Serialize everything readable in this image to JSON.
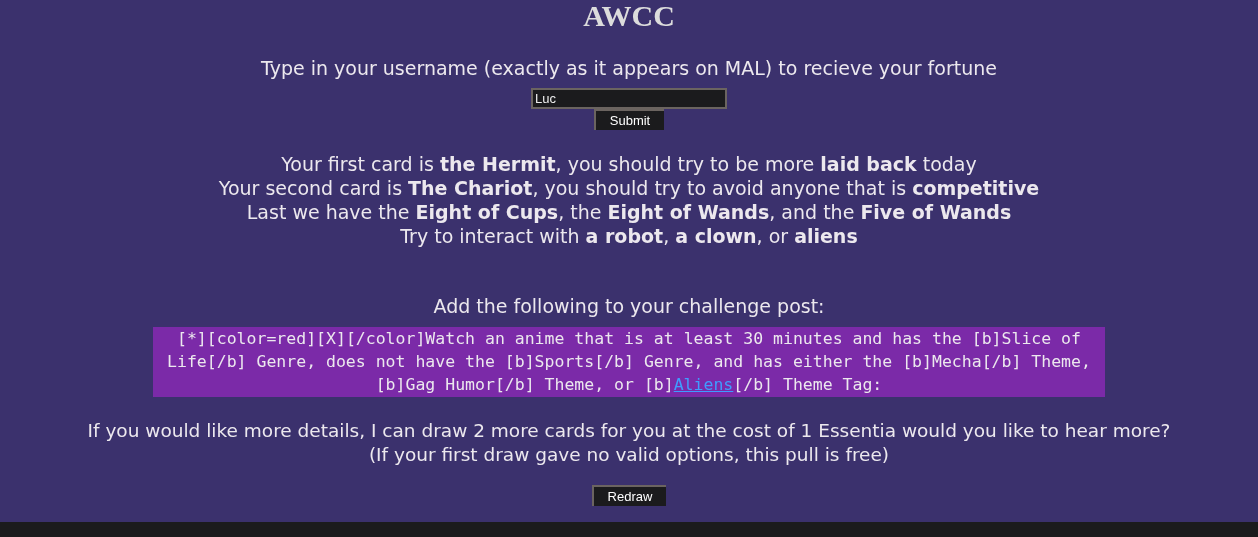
{
  "title": "AWCC",
  "prompt": "Type in your username (exactly as it appears on MAL) to recieve your fortune",
  "username_field": {
    "value": "Luc"
  },
  "submit_button": "Submit",
  "fortune_lines": [
    "Your first card is **the Hermit**, you should try to be more **laid back** today",
    "Your second card is **The Chariot**, you should try to avoid anyone that is **competitive**",
    "Last we have the **Eight of Cups**, the **Eight of Wands**, and the **Five of Wands**",
    "Try to interact with **a robot**, **a clown**, or **aliens**"
  ],
  "challenge_heading": "Add the following to your challenge post:",
  "challenge_code": {
    "before": "[*][color=red][X][/color]Watch an anime that is at least 30 minutes and has the [b]Slice of Life[/b] Genre, does not have the [b]Sports[/b] Genre, and has either the [b]Mecha[/b] Theme, [b]Gag Humor[/b] Theme, or [b]",
    "link": "Aliens",
    "after": "[/b] Theme Tag:"
  },
  "offer_lines": [
    "If you would like more details, I can draw 2 more cards for you at the cost of 1 Essentia would you like to hear more?",
    "(If your first draw gave no valid options, this pull is free)"
  ],
  "redraw_button": "Redraw"
}
